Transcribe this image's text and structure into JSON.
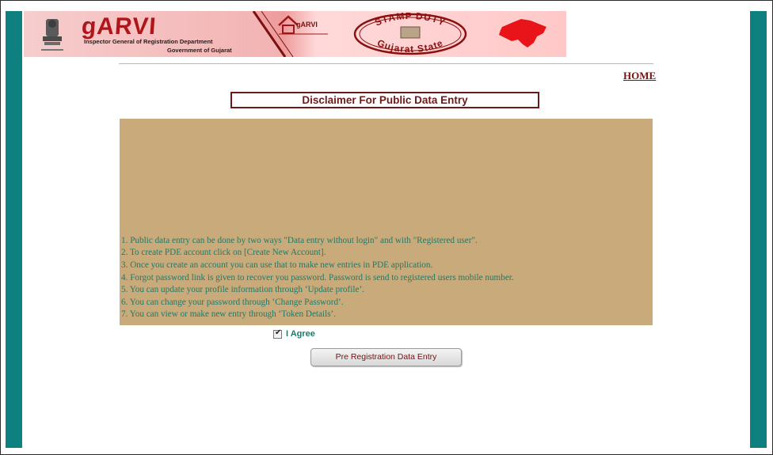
{
  "header": {
    "app_title": "gARVI",
    "department": "Inspector General of Registration Department",
    "government": "Government of Gujarat",
    "house_logo_text": "gARVI",
    "stamp_top": "STAMP DUTY",
    "stamp_bottom": "Gujarat State"
  },
  "nav": {
    "home_label": "HOME"
  },
  "disclaimer": {
    "title": "Disclaimer For Public Data Entry",
    "items": [
      "1. Public data entry can be done by two ways \"Data entry without login\" and with \"Registered user\".",
      "2. To create PDE account click on [Create New Account].",
      "3. Once you create an account you can use that to make new entries in PDE application.",
      "4. Forgot password link is given to recover you password. Password is send to registered users mobile number.",
      "5. You can update your profile information through ‘Update profile’.",
      "6. You can change your password through ‘Change Password’.",
      "7. You can view or make new entry through ‘Token Details’."
    ]
  },
  "agree": {
    "label": "I Agree",
    "checked": true
  },
  "actions": {
    "pde_button_label": "Pre Registration Data Entry"
  },
  "colors": {
    "teal": "#0f8080",
    "maroon": "#6b1a1a",
    "panel": "#c9aa7a",
    "text_green": "#1e7a6a"
  }
}
